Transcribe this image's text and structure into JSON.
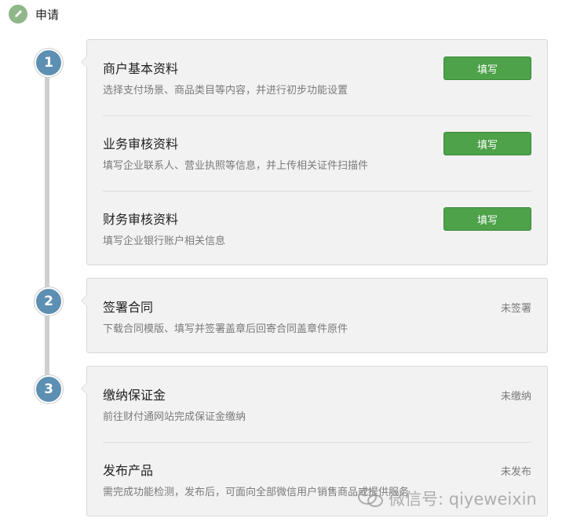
{
  "header": {
    "title": "申请",
    "icon": "pen-icon"
  },
  "steps": [
    {
      "number": "1",
      "items": [
        {
          "title": "商户基本资料",
          "desc": "选择支付场景、商品类目等内容，并进行初步功能设置",
          "action": "填写"
        },
        {
          "title": "业务审核资料",
          "desc": "填写企业联系人、营业执照等信息，并上传相关证件扫描件",
          "action": "填写"
        },
        {
          "title": "财务审核资料",
          "desc": "填写企业银行账户相关信息",
          "action": "填写"
        }
      ]
    },
    {
      "number": "2",
      "items": [
        {
          "title": "签署合同",
          "desc": "下载合同模版、填写并签署盖章后回寄合同盖章件原件",
          "status": "未签署"
        }
      ]
    },
    {
      "number": "3",
      "items": [
        {
          "title": "缴纳保证金",
          "desc": "前往财付通网站完成保证金缴纳",
          "status": "未缴纳"
        },
        {
          "title": "发布产品",
          "desc": "需完成功能检测，发布后，可面向全部微信用户销售商品或提供服务",
          "status": "未发布"
        }
      ]
    }
  ],
  "watermark": {
    "text": "微信号: qiyeweixin",
    "icon": "wechat-icon"
  },
  "colors": {
    "accent_green": "#4ea24a",
    "step_blue": "#5d8fb3",
    "card_bg": "#f2f2f2"
  }
}
